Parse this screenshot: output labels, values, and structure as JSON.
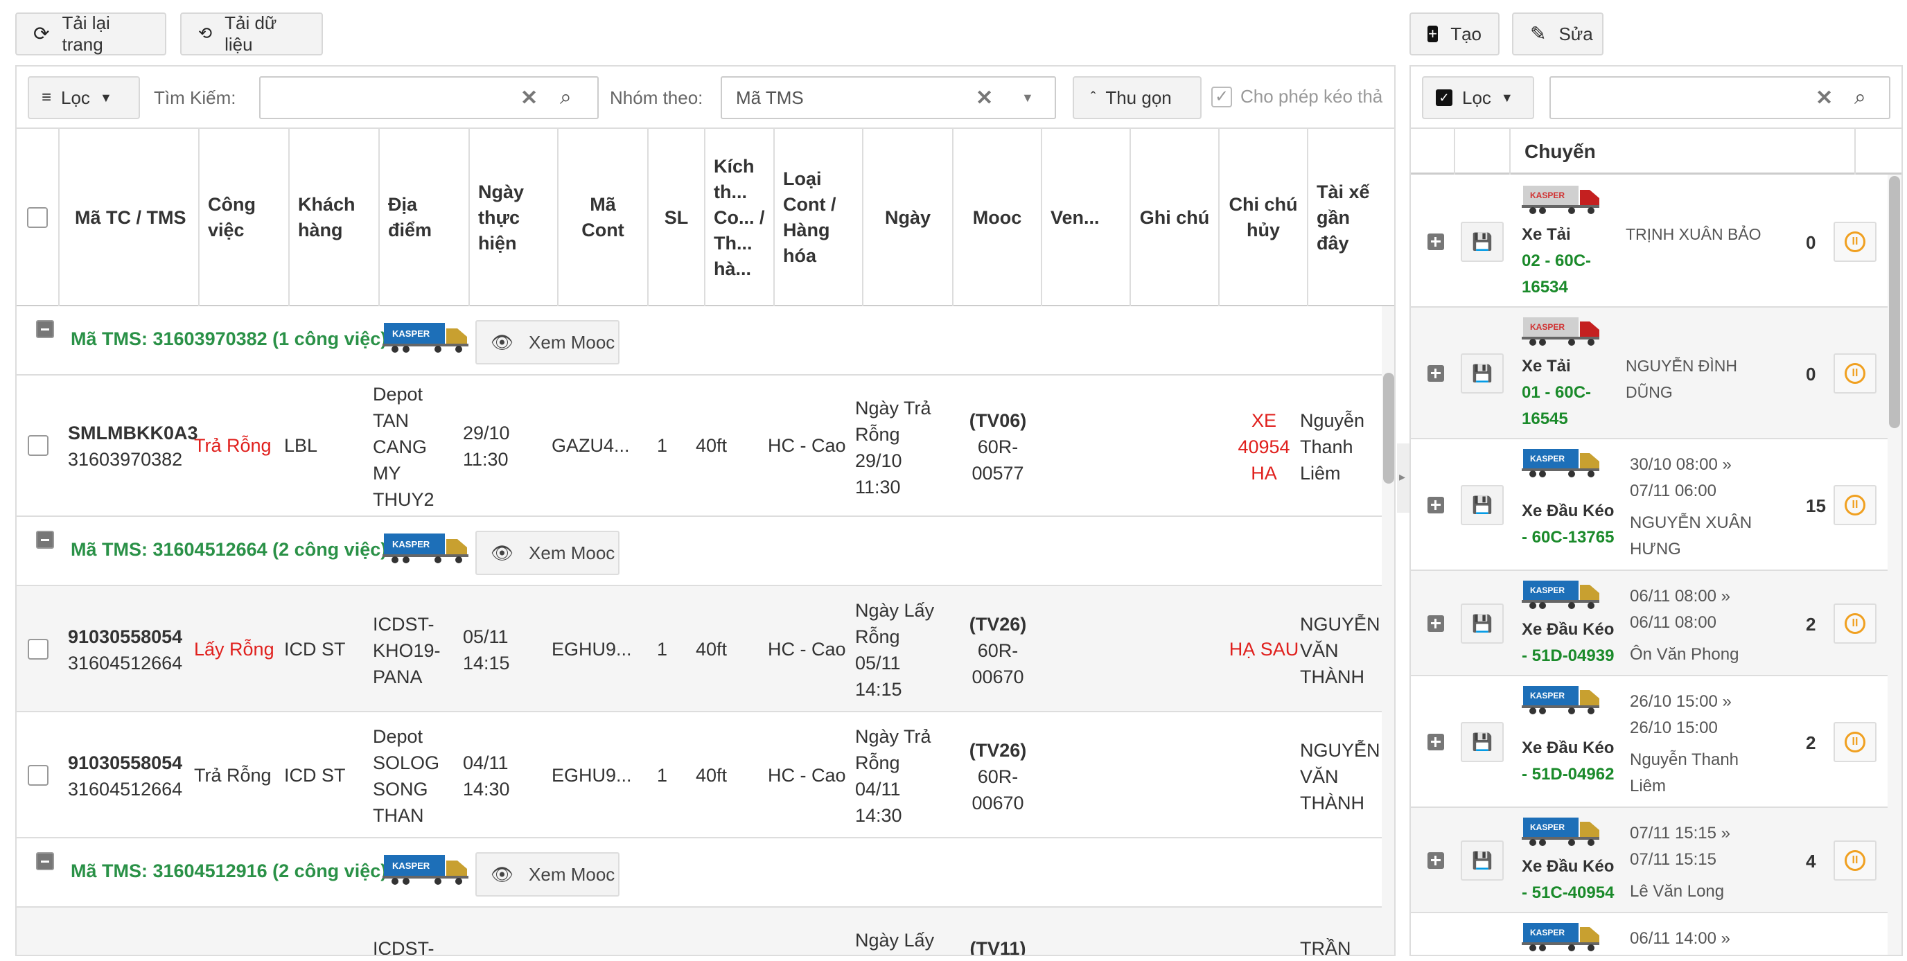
{
  "top_left_buttons": {
    "reload_page": "Tải lại trang",
    "reload_data": "Tải dữ liệu"
  },
  "top_right_buttons": {
    "create": "Tạo",
    "edit": "Sửa"
  },
  "toolbar": {
    "filter_label": "Lọc",
    "search_label": "Tìm Kiếm:",
    "search_value": "",
    "group_by_label": "Nhóm theo:",
    "group_by_value": "Mã TMS",
    "collapse_label": "Thu gọn",
    "allow_drag_label": "Cho phép kéo thả",
    "allow_drag_checked": true
  },
  "columns": [
    "Mã TC / TMS",
    "Công việc",
    "Khách hàng",
    "Địa điểm",
    "Ngày thực hiện",
    "Mã Cont",
    "SL",
    "Kích th... Co... / Th... hà...",
    "Loại Cont / Hàng hóa",
    "Ngày",
    "Mooc",
    "Ven...",
    "Ghi chú",
    "Chi chú hủy",
    "Tài xế gần đây"
  ],
  "truck_logo_text": "KASPER",
  "view_mooc_label": "Xem Mooc",
  "groups": [
    {
      "title": "Mã TMS: 31603970382 (1 công việc)"
    },
    {
      "title": "Mã TMS: 31604512664 (2 công việc)"
    },
    {
      "title": "Mã TMS: 31604512916 (2 công việc)"
    }
  ],
  "rows": [
    {
      "ma_tc": "SMLMBKK0A3",
      "tms": "31603970382",
      "cong_viec": "Trả Rỗng",
      "cong_viec_red": true,
      "khach_hang": "LBL",
      "dia_diem": [
        "Depot",
        "TAN",
        "CANG",
        "MY",
        "THUY2"
      ],
      "ngay_th": [
        "29/10",
        "11:30"
      ],
      "ma_cont": "GAZU4...",
      "sl": "1",
      "kich_thuoc": "40ft",
      "loai_cont": "HC - Cao",
      "ngay": [
        "Ngày Trả",
        "Rỗng",
        "29/10",
        "11:30"
      ],
      "mooc_code": "(TV06)",
      "mooc": [
        "60R-",
        "00577"
      ],
      "ghi_chu_huy": [
        "XE",
        "40954",
        "HA"
      ],
      "tai_xe": [
        "Nguyễn",
        "Thanh",
        "Liêm"
      ]
    },
    {
      "ma_tc": "91030558054",
      "tms": "31604512664",
      "cong_viec": "Lấy Rỗng",
      "cong_viec_red": true,
      "khach_hang": "ICD ST",
      "dia_diem": [
        "ICDST-",
        "KHO19-",
        "PANA"
      ],
      "ngay_th": [
        "05/11",
        "14:15"
      ],
      "ma_cont": "EGHU9...",
      "sl": "1",
      "kich_thuoc": "40ft",
      "loai_cont": "HC - Cao",
      "ngay": [
        "Ngày Lấy",
        "Rỗng",
        "05/11",
        "14:15"
      ],
      "mooc_code": "(TV26)",
      "mooc": [
        "60R-",
        "00670"
      ],
      "ghi_chu_huy": [
        "HẠ SAU"
      ],
      "tai_xe": [
        "NGUYỄN",
        "VĂN",
        "THÀNH"
      ]
    },
    {
      "ma_tc": "91030558054",
      "tms": "31604512664",
      "cong_viec": "Trả Rỗng",
      "cong_viec_red": false,
      "khach_hang": "ICD ST",
      "dia_diem": [
        "Depot",
        "SOLOG",
        "SONG",
        "THAN"
      ],
      "ngay_th": [
        "04/11",
        "14:30"
      ],
      "ma_cont": "EGHU9...",
      "sl": "1",
      "kich_thuoc": "40ft",
      "loai_cont": "HC - Cao",
      "ngay": [
        "Ngày Trả",
        "Rỗng",
        "04/11",
        "14:30"
      ],
      "mooc_code": "(TV26)",
      "mooc": [
        "60R-",
        "00670"
      ],
      "ghi_chu_huy": [],
      "tai_xe": [
        "NGUYỄN",
        "VĂN",
        "THÀNH"
      ]
    },
    {
      "ma_tc": "",
      "tms": "",
      "cong_viec": "",
      "cong_viec_red": false,
      "khach_hang": "",
      "dia_diem": [
        "ICDST-"
      ],
      "ngay_th": [],
      "ma_cont": "",
      "sl": "",
      "kich_thuoc": "",
      "loai_cont": "",
      "ngay": [
        "Ngày Lấy"
      ],
      "mooc_code": "(TV11)",
      "mooc": [],
      "ghi_chu_huy": [],
      "tai_xe": [
        "TRẦN"
      ]
    }
  ],
  "right_panel": {
    "filter_label": "Lọc",
    "search_value": "",
    "header_title": "Chuyến",
    "vehicles": [
      {
        "type": "Xe Tải",
        "plate": "02 - 60C-16534",
        "dates": [],
        "driver": [
          "TRỊNH XUÂN BẢO"
        ],
        "count": "0",
        "truck": "red"
      },
      {
        "type": "Xe Tải",
        "plate": "01 - 60C-16545",
        "dates": [],
        "driver": [
          "NGUYỄN ĐÌNH",
          "DŨNG"
        ],
        "count": "0",
        "truck": "red"
      },
      {
        "type": "Xe Đầu Kéo",
        "plate": "- 60C-13765",
        "dates": [
          "30/10 08:00 »",
          "07/11 06:00"
        ],
        "driver": [
          "NGUYỄN XUÂN",
          "HƯNG"
        ],
        "count": "15",
        "truck": "blue"
      },
      {
        "type": "Xe Đầu Kéo",
        "plate": "- 51D-04939",
        "dates": [
          "06/11 08:00 »",
          "06/11 08:00"
        ],
        "driver": [
          "Ôn Văn Phong"
        ],
        "count": "2",
        "truck": "blue"
      },
      {
        "type": "Xe Đầu Kéo",
        "plate": "- 51D-04962",
        "dates": [
          "26/10 15:00 »",
          "26/10 15:00"
        ],
        "driver": [
          "Nguyễn Thanh",
          "Liêm"
        ],
        "count": "2",
        "truck": "blue"
      },
      {
        "type": "Xe Đầu Kéo",
        "plate": "- 51C-40954",
        "dates": [
          "07/11 15:15 »",
          "07/11 15:15"
        ],
        "driver": [
          "Lê Văn Long"
        ],
        "count": "4",
        "truck": "blue"
      },
      {
        "type": "",
        "plate": "",
        "dates": [
          "06/11 14:00 »"
        ],
        "driver": [],
        "count": "",
        "truck": "blue"
      }
    ]
  }
}
